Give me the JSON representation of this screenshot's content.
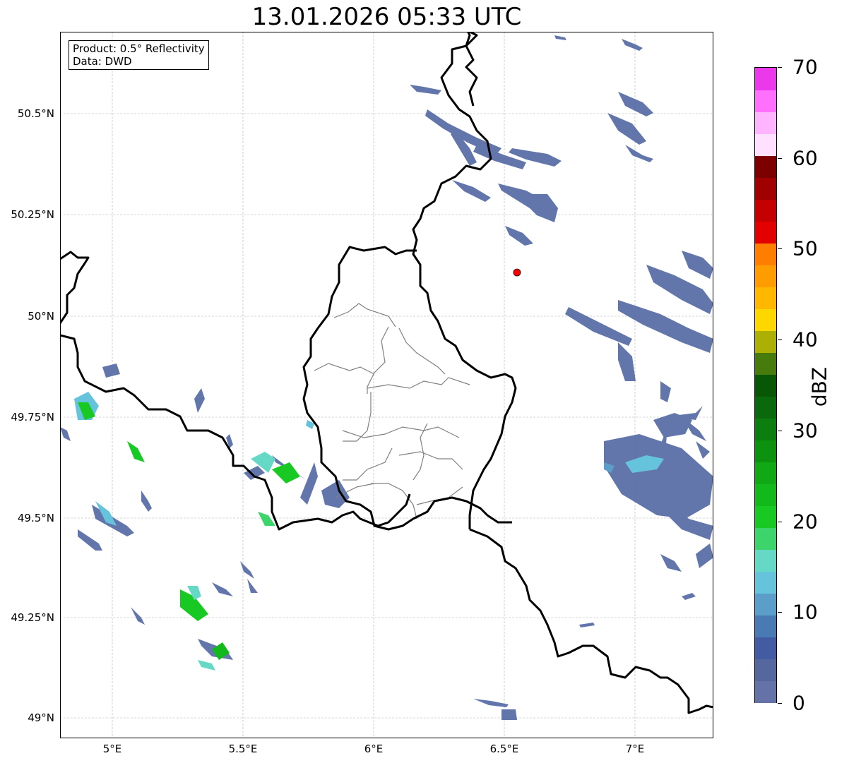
{
  "title": "13.01.2026 05:33 UTC",
  "info": {
    "product": "Product: 0.5° Reflectivity",
    "data_source": "Data: DWD"
  },
  "axes": {
    "lat_labels": [
      "50.5°N",
      "50.25°N",
      "50°N",
      "49.75°N",
      "49.5°N",
      "49.25°N",
      "49°N"
    ],
    "lon_labels": [
      "5°E",
      "5.5°E",
      "6°E",
      "6.5°E",
      "7°E"
    ],
    "lat_values": [
      50.5,
      50.25,
      50.0,
      49.75,
      49.5,
      49.25,
      49.0
    ],
    "lon_values": [
      5.0,
      5.5,
      6.0,
      6.5,
      7.0
    ],
    "lat_range": [
      48.95,
      50.7
    ],
    "lon_range": [
      4.8,
      7.3
    ],
    "grid": true
  },
  "radar_site_marker": {
    "lat": 50.11,
    "lon": 6.55,
    "color": "#ff0000"
  },
  "colorbar": {
    "unit": "dBZ",
    "min": 0,
    "max": 70,
    "tick_labels": [
      "70",
      "60",
      "50",
      "40",
      "30",
      "20",
      "10",
      "0"
    ],
    "tick_values": [
      70,
      60,
      50,
      40,
      30,
      20,
      10,
      0
    ],
    "colors": [
      "#6472a8",
      "#55679f",
      "#435ba3",
      "#4a7ab3",
      "#5a9ec9",
      "#66c3dc",
      "#66d8c6",
      "#3ed46c",
      "#17c922",
      "#13b91a",
      "#10a814",
      "#0d9210",
      "#0c7d0f",
      "#0a690c",
      "#085707",
      "#477b0b",
      "#adb004",
      "#ffd700",
      "#ffb700",
      "#ff9c00",
      "#ff7e00",
      "#e30000",
      "#c40000",
      "#a00000",
      "#7c0000",
      "#ffe0ff",
      "#ffb4ff",
      "#ff70ff",
      "#eb38eb"
    ]
  }
}
